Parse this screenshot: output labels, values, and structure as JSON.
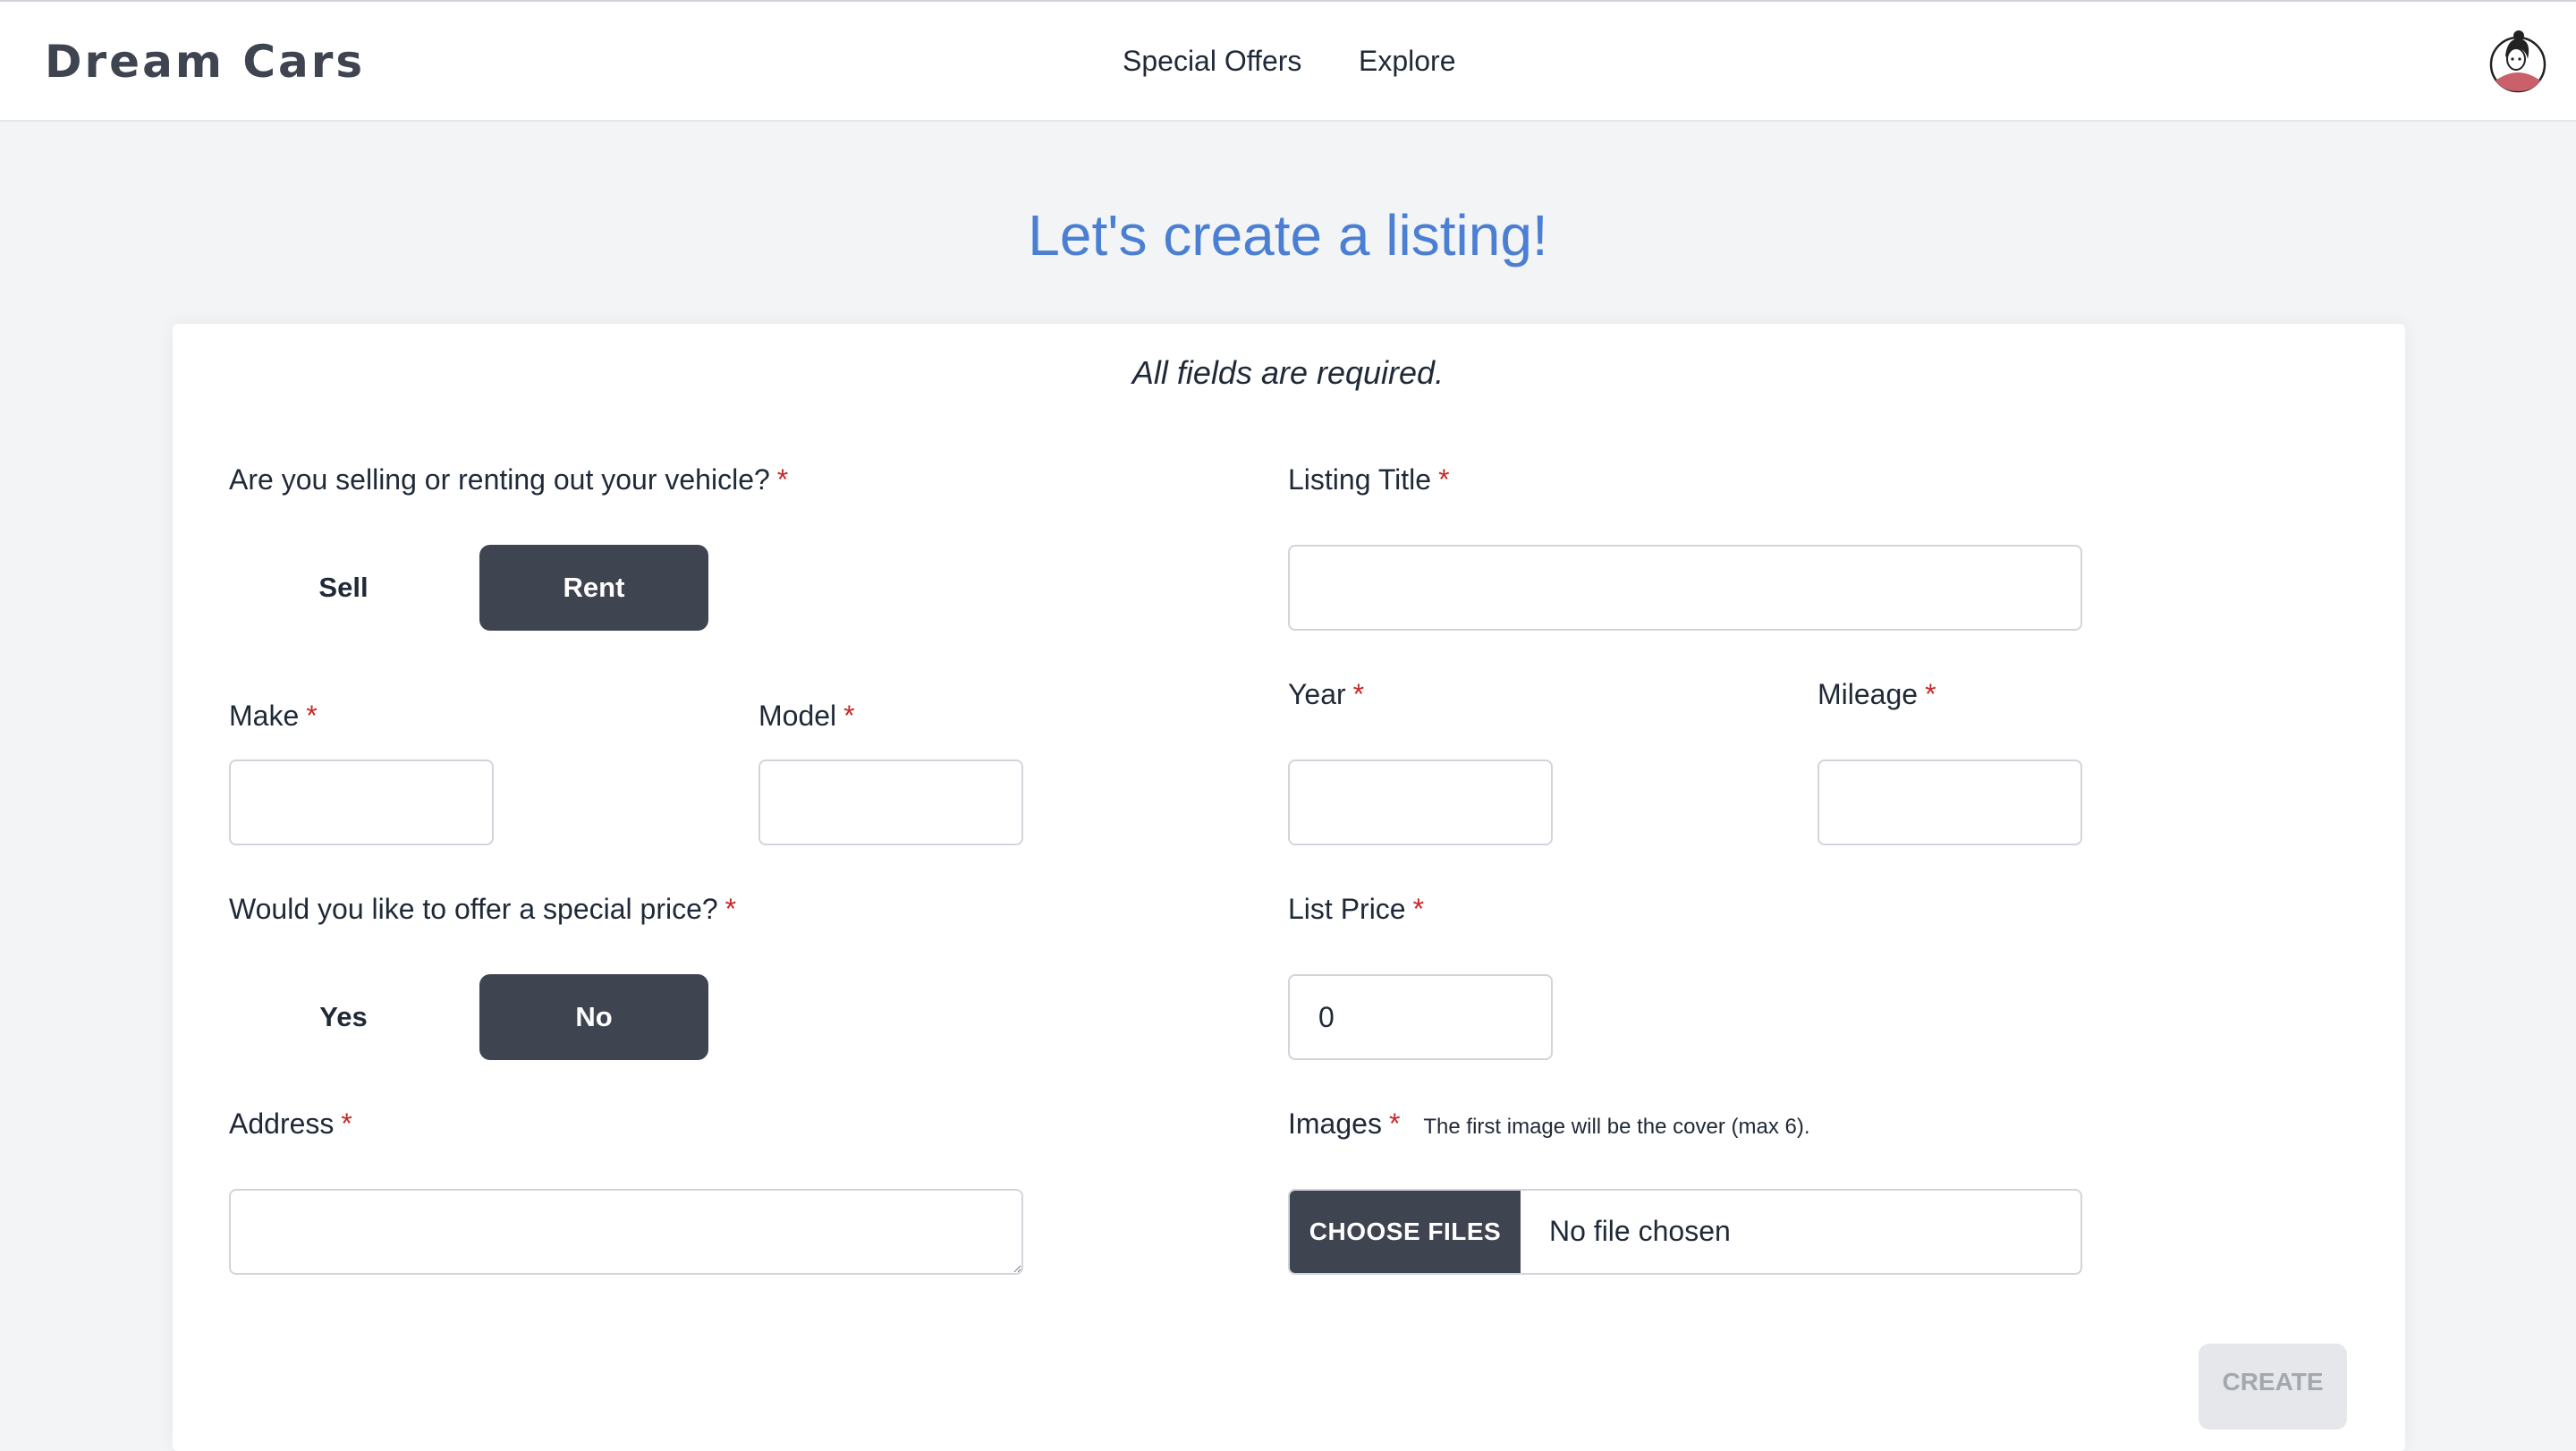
{
  "header": {
    "brand": "Dream Cars",
    "nav": [
      "Special Offers",
      "Explore"
    ]
  },
  "page": {
    "title": "Let's create a listing!",
    "note": "All fields are required."
  },
  "form": {
    "offer_type": {
      "label": "Are you selling or renting out your vehicle?",
      "options": [
        "Sell",
        "Rent"
      ],
      "selected": "Rent"
    },
    "listing_title": {
      "label": "Listing Title",
      "value": ""
    },
    "make": {
      "label": "Make",
      "value": ""
    },
    "model": {
      "label": "Model",
      "value": ""
    },
    "year": {
      "label": "Year",
      "value": ""
    },
    "mileage": {
      "label": "Mileage",
      "value": ""
    },
    "special_price": {
      "label": "Would you like to offer a special price?",
      "options": [
        "Yes",
        "No"
      ],
      "selected": "No"
    },
    "list_price": {
      "label": "List Price",
      "value": "0"
    },
    "address": {
      "label": "Address",
      "value": ""
    },
    "images": {
      "label": "Images",
      "hint": "The first image will be the cover (max 6).",
      "button_label": "CHOOSE FILES",
      "status": "No file chosen"
    },
    "required_marker": "*",
    "submit_label": "CREATE",
    "submit_enabled": false
  },
  "colors": {
    "accent": "#4a7fd3",
    "dark": "#3f4451",
    "required": "#c62828"
  },
  "icons": [
    "user-avatar-icon"
  ]
}
